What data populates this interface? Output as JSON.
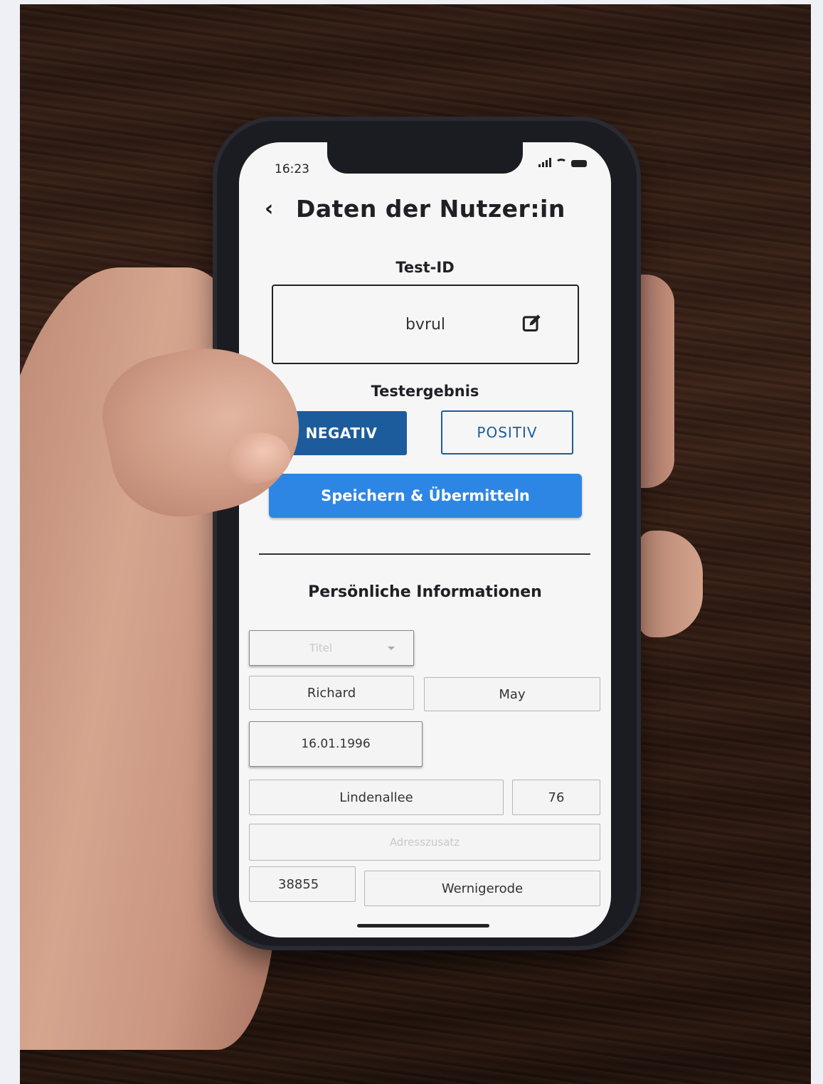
{
  "status_bar": {
    "time": "16:23"
  },
  "header": {
    "back_icon": "chevron-left-icon",
    "title": "Daten der Nutzer:in"
  },
  "test_id": {
    "label": "Test-ID",
    "value": "bvrul",
    "edit_icon": "edit-icon"
  },
  "test_result": {
    "label": "Testergebnis",
    "negative_label": "NEGATIV",
    "positive_label": "POSITIV",
    "selected": "NEGATIV"
  },
  "save_button": {
    "label": "Speichern & Übermitteln"
  },
  "personal_info": {
    "heading": "Persönliche Informationen",
    "title_placeholder": "Titel",
    "first_name": "Richard",
    "last_name": "May",
    "birth_date": "16.01.1996",
    "street": "Lindenallee",
    "house_number": "76",
    "address_suffix_placeholder": "Adresszusatz",
    "postal_code": "38855",
    "city": "Wernigerode"
  },
  "colors": {
    "primary_dark": "#1d5c9c",
    "primary": "#2d86e3"
  }
}
